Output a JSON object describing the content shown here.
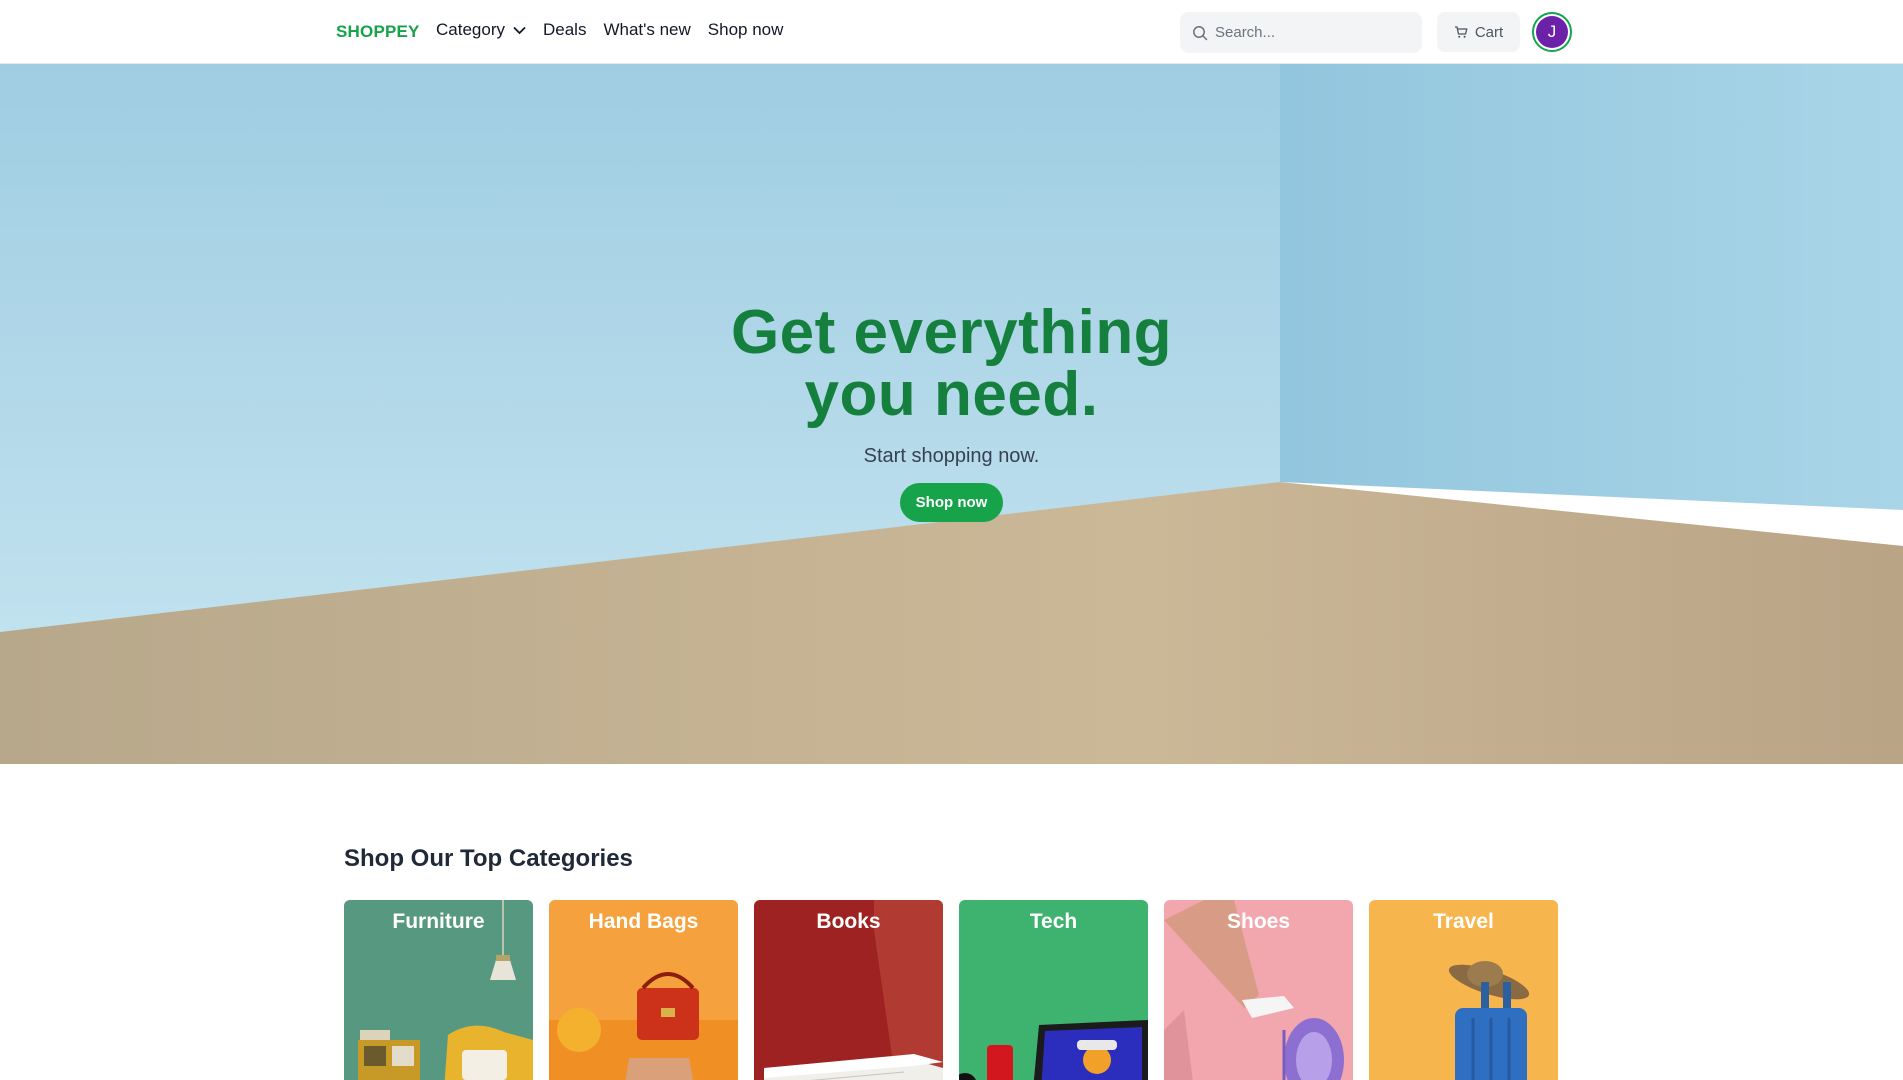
{
  "header": {
    "logo": "SHOPPEY",
    "nav": [
      {
        "label": "Category",
        "has_dropdown": true
      },
      {
        "label": "Deals"
      },
      {
        "label": "What's new"
      },
      {
        "label": "Shop now"
      }
    ],
    "search_placeholder": "Search...",
    "cart_label": "Cart",
    "avatar_initial": "J"
  },
  "hero": {
    "title_line1": "Get everything",
    "title_line2": "you need.",
    "subtitle": "Start shopping now.",
    "cta_label": "Shop now"
  },
  "categories": {
    "title": "Shop Our Top Categories",
    "items": [
      {
        "label": "Furniture",
        "color": "#5fa58a"
      },
      {
        "label": "Hand Bags",
        "color": "#f5a13d"
      },
      {
        "label": "Books",
        "color": "#a32525"
      },
      {
        "label": "Tech",
        "color": "#3db36f"
      },
      {
        "label": "Shoes",
        "color": "#f2a7ae"
      },
      {
        "label": "Travel",
        "color": "#f7b54e"
      }
    ]
  },
  "colors": {
    "brand": "#16a34a",
    "avatar_bg": "#6b21a8",
    "sky": "#a7d3e6",
    "floor": "#c7b391"
  }
}
